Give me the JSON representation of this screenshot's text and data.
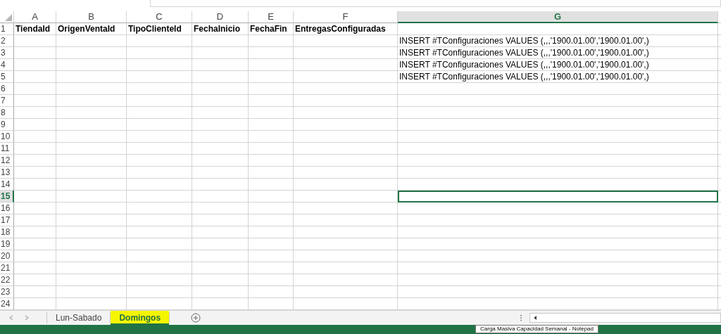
{
  "columns": [
    {
      "label": "A",
      "selected": false
    },
    {
      "label": "B",
      "selected": false
    },
    {
      "label": "C",
      "selected": false
    },
    {
      "label": "D",
      "selected": false
    },
    {
      "label": "E",
      "selected": false
    },
    {
      "label": "F",
      "selected": false
    },
    {
      "label": "G",
      "selected": true
    }
  ],
  "rows": [
    {
      "number": "1",
      "selected": false,
      "kind": "header",
      "cells": [
        "TiendaId",
        "OrigenVentaId",
        "TipoClienteId",
        "FechaInicio",
        "FechaFin",
        "EntregasConfiguradas",
        null
      ]
    },
    {
      "number": "2",
      "selected": false,
      "kind": "data",
      "cells": [
        null,
        null,
        null,
        null,
        null,
        null,
        "INSERT #TConfiguraciones VALUES (,,,'1900.01.00','1900.01.00',)"
      ]
    },
    {
      "number": "3",
      "selected": false,
      "kind": "data",
      "cells": [
        null,
        null,
        null,
        null,
        null,
        null,
        "INSERT #TConfiguraciones VALUES (,,,'1900.01.00','1900.01.00',)"
      ]
    },
    {
      "number": "4",
      "selected": false,
      "kind": "data",
      "cells": [
        null,
        null,
        null,
        null,
        null,
        null,
        "INSERT #TConfiguraciones VALUES (,,,'1900.01.00','1900.01.00',)"
      ]
    },
    {
      "number": "5",
      "selected": false,
      "kind": "data",
      "cells": [
        null,
        null,
        null,
        null,
        null,
        null,
        "INSERT #TConfiguraciones VALUES (,,,'1900.01.00','1900.01.00',)"
      ]
    },
    {
      "number": "6",
      "selected": false
    },
    {
      "number": "7",
      "selected": false
    },
    {
      "number": "8",
      "selected": false
    },
    {
      "number": "9",
      "selected": false
    },
    {
      "number": "10",
      "selected": false
    },
    {
      "number": "11",
      "selected": false
    },
    {
      "number": "12",
      "selected": false
    },
    {
      "number": "13",
      "selected": false
    },
    {
      "number": "14",
      "selected": false
    },
    {
      "number": "15",
      "selected": true
    },
    {
      "number": "16",
      "selected": false
    },
    {
      "number": "17",
      "selected": false
    },
    {
      "number": "18",
      "selected": false
    },
    {
      "number": "19",
      "selected": false
    },
    {
      "number": "20",
      "selected": false
    },
    {
      "number": "21",
      "selected": false
    },
    {
      "number": "22",
      "selected": false
    },
    {
      "number": "23",
      "selected": false
    },
    {
      "number": "24",
      "selected": false
    }
  ],
  "sheet_tabs": [
    {
      "label": "Lun-Sabado",
      "selected": false,
      "highlighted": false
    },
    {
      "label": "Domingos",
      "selected": true,
      "highlighted": true
    }
  ],
  "tooltip": "Carga Masiva Capacidad Semanal - Notepad"
}
